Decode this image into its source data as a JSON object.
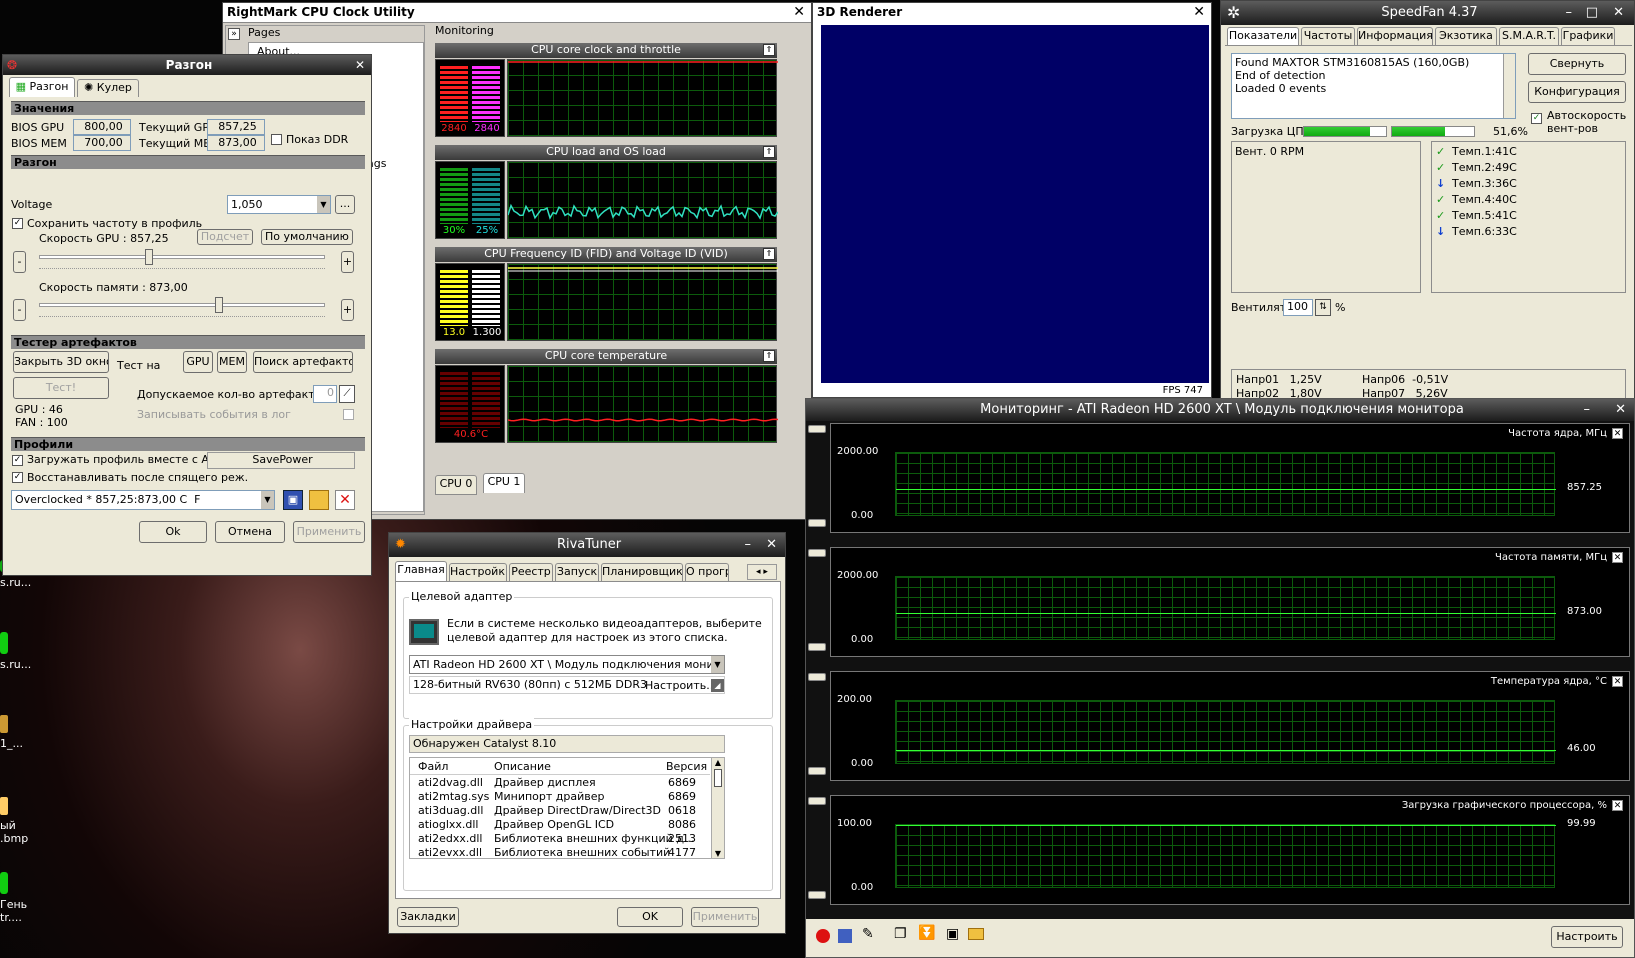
{
  "rightmark": {
    "title": "RightMark CPU Clock Utility",
    "pages_label": "Pages",
    "about": "About...",
    "partial_text": "ags",
    "monitoring_label": "Monitoring",
    "graphs": [
      {
        "title": "CPU core clock and throttle",
        "v1": "2840",
        "v2": "2840",
        "c1": "#ff2020",
        "c2": "#ff30ff"
      },
      {
        "title": "CPU load and OS load",
        "v1": "30%",
        "v2": "25%",
        "c1": "#20ff20",
        "c2": "#20e0e0"
      },
      {
        "title": "CPU Frequency ID (FID) and Voltage ID (VID)",
        "v1": "13.0",
        "v2": "1.300",
        "c1": "#ffff20",
        "c2": "#ffffff"
      },
      {
        "title": "CPU core temperature",
        "v1": "40.6°C",
        "v2": "",
        "c1": "#ff2020",
        "c2": "#ff2020"
      }
    ],
    "tabs": [
      "CPU 0",
      "CPU 1"
    ]
  },
  "renderer": {
    "title": "3D Renderer",
    "fps": "FPS 747",
    "bg": "#000066"
  },
  "razgon": {
    "title": "Разгон",
    "tab_oc": "Разгон",
    "tab_cooler": "Кулер",
    "sec_values": "Значения",
    "bios_gpu_lbl": "BIOS GPU",
    "bios_gpu": "800,00",
    "cur_gpu_lbl": "Текущий GPU",
    "cur_gpu": "857,25",
    "bios_mem_lbl": "BIOS MEM",
    "bios_mem": "700,00",
    "cur_mem_lbl": "Текущий MEM",
    "cur_mem": "873,00",
    "ddr": "Показ DDR",
    "sec_oc": "Разгон",
    "voltage_lbl": "Voltage",
    "voltage": "1,050",
    "dots": "...",
    "save_freq": "Сохранить частоту в профиль",
    "gpu_speed": "Скорость GPU : 857,25",
    "calc": "Подсчет",
    "default": "По умолчанию",
    "mem_speed": "Скорость памяти : 873,00",
    "sec_tester": "Тестер артефактов",
    "close3d": "Закрыть 3D окно",
    "test_on": "Тест на",
    "gpu": "GPU",
    "mem": "MEM",
    "search": "Поиск артефактов",
    "test": "Тест!",
    "allowed": "Допускаемое кол-во артефактов",
    "allowed_val": "0",
    "log": "Записывать события в лог",
    "gpu_stat": "GPU : 46",
    "fan_stat": "FAN : 100",
    "sec_profiles": "Профили",
    "load_profile": "Загружать профиль вместе с ATT",
    "savepower": "SavePower",
    "restore": "Восстанавливать после спящего реж.",
    "profile_sel": "Overclocked * 857,25:873,00 C  F",
    "ok": "Ok",
    "cancel": "Отмена",
    "apply": "Применить"
  },
  "speedfan": {
    "title": "SpeedFan 4.37",
    "tabs": [
      "Показатели",
      "Частоты",
      "Информация",
      "Экзотика",
      "S.M.A.R.T.",
      "Графики"
    ],
    "log": [
      "Found MAXTOR STM3160815AS (160,0GB)",
      "End of detection",
      "Loaded 0 events"
    ],
    "collapse": "Свернуть",
    "config": "Конфигурация",
    "auto": "Автоскорость вент-ров",
    "cpu_load_lbl": "Загрузка ЦП",
    "cpu_load": "51,6%",
    "cpu1": 0.8,
    "cpu2": 0.65,
    "fans": "Вент. 0 RPM",
    "temps": [
      {
        "t": "Темп.1:41C",
        "ok": true
      },
      {
        "t": "Темп.2:49C",
        "ok": true
      },
      {
        "t": "Темп.3:36C",
        "ok": false
      },
      {
        "t": "Темп.4:40C",
        "ok": true
      },
      {
        "t": "Темп.5:41C",
        "ok": true
      },
      {
        "t": "Темп.6:33C",
        "ok": false
      }
    ],
    "fan_lbl": "Вентилят",
    "fan_val": "100",
    "pct": "%",
    "volts": [
      "Напр01   1,25V",
      "Напр06  -0,51V",
      "Напр02   1,80V",
      "Напр07   5,26V"
    ]
  },
  "rivatuner": {
    "title": "RivaTuner",
    "tabs": [
      "Главная",
      "Настройки",
      "Реестр",
      "Запуск",
      "Планировщик",
      "О прогр"
    ],
    "target_grp": "Целевой адаптер",
    "target_desc": "Если в системе несколько видеоадаптеров, выберите целевой адаптер для настроек из этого списка.",
    "adapter": "ATI Radeon HD 2600 XT \\ Модуль подключения монитора",
    "adapter_info": "128-битный RV630 (80пп) с 512МБ DDR3",
    "customize": "Настроить...",
    "driver_grp": "Настройки драйвера",
    "catalyst": "Обнаружен Catalyst 8.10",
    "cols": [
      "Файл",
      "Описание",
      "Версия"
    ],
    "files": [
      [
        "ati2dvag.dll",
        "Драйвер дисплея",
        "6869"
      ],
      [
        "ati2mtag.sys",
        "Минипорт драйвер",
        "6869"
      ],
      [
        "ati3duag.dll",
        "Драйвер DirectDraw/Direct3D",
        "0618"
      ],
      [
        "atioglxx.dll",
        "Драйвер OpenGL ICD",
        "8086"
      ],
      [
        "ati2edxx.dll",
        "Библиотека внешних функций д...",
        "2513"
      ],
      [
        "ati2evxx.dll",
        "Библиотека внешних событий",
        "4177"
      ]
    ],
    "bookmarks": "Закладки",
    "ok": "OK",
    "apply": "Применить"
  },
  "atimon": {
    "title": "Мониторинг - ATI Radeon HD 2600 XT \\ Модуль подключения монитора",
    "graphs": [
      {
        "name": "Частота ядра, МГц",
        "max": "2000.00",
        "min": "0.00",
        "cur": "857.25",
        "level": 0.43
      },
      {
        "name": "Частота памяти, МГц",
        "max": "2000.00",
        "min": "0.00",
        "cur": "873.00",
        "level": 0.44
      },
      {
        "name": "Температура ядра, °С",
        "max": "200.00",
        "min": "0.00",
        "cur": "46.00",
        "level": 0.23
      },
      {
        "name": "Загрузка графического процессора, %",
        "max": "100.00",
        "min": "0.00",
        "cur": "99.99",
        "level": 1.0
      }
    ],
    "setup": "Настроить"
  },
  "desktop": {
    "icons": [
      "s.ru...",
      "s.ru...",
      "1_...",
      "ый\n.bmp",
      "Гень\ntr...."
    ]
  }
}
